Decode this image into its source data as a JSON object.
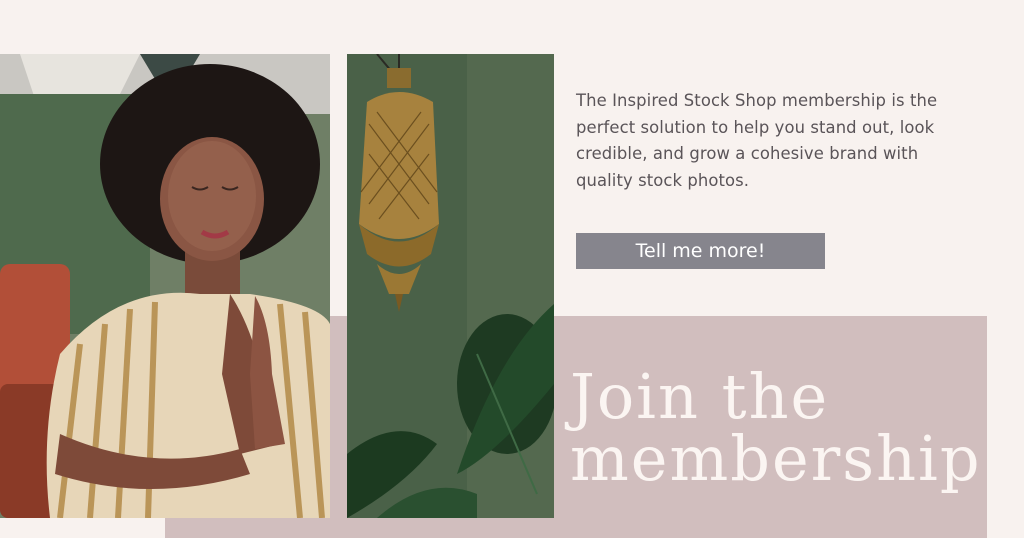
{
  "promo": {
    "description": "The Inspired Stock Shop membership is the perfect solution to help you stand out, look credible, and grow a cohesive brand with quality stock photos.",
    "button_label": "Tell me more!",
    "headline_line1": "Join the",
    "headline_line2": "membership"
  },
  "colors": {
    "page_background": "#f8f2ef",
    "accent_block": "#d1bebe",
    "button_background": "#86858d",
    "body_text": "#5a5458",
    "headline_text": "#fbf5f2"
  },
  "images": [
    {
      "name": "woman-praying-photo"
    },
    {
      "name": "brass-lantern-photo"
    }
  ]
}
